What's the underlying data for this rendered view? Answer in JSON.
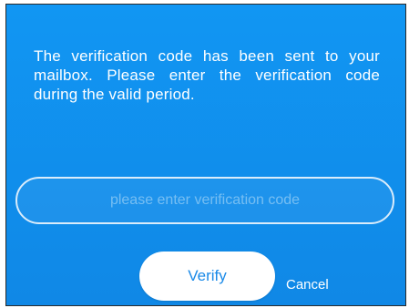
{
  "dialog": {
    "message": "The verification code has been sent to your mailbox. Please enter the verification code during the valid period.",
    "code_input": {
      "placeholder": "please enter verification code",
      "value": ""
    },
    "verify_label": "Verify",
    "cancel_label": "Cancel"
  },
  "colors": {
    "background": "#1196f3",
    "button": "#ffffff",
    "button_text": "#1a8ae8"
  }
}
